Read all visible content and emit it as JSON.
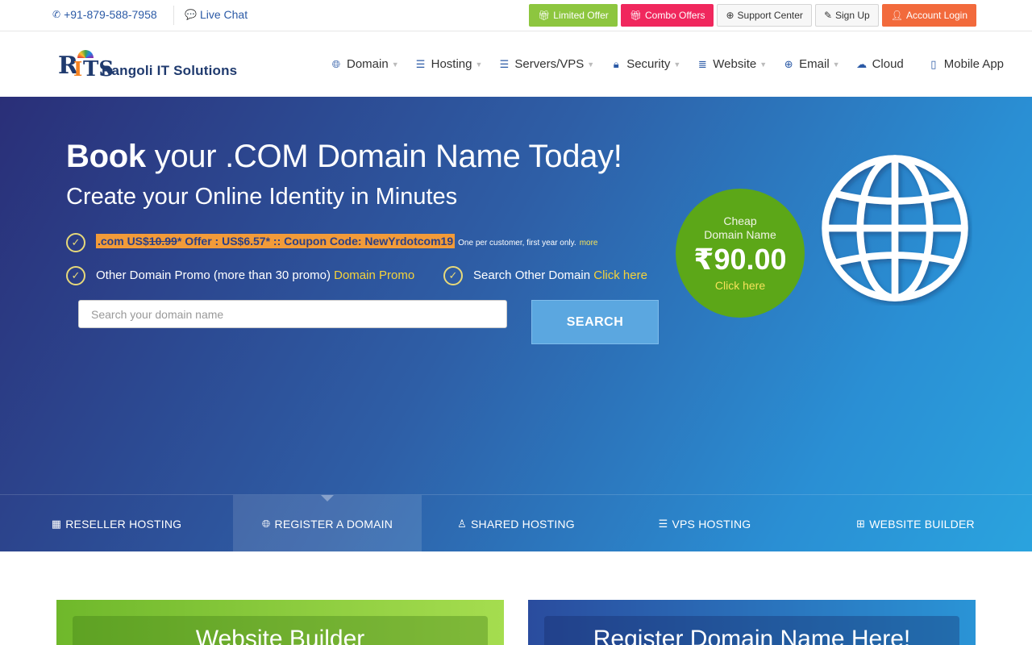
{
  "topbar": {
    "phone": "+91-879-588-7958",
    "chat": "Live Chat",
    "buttons": [
      {
        "label": "Limited Offer",
        "icon": "gift-icon",
        "color": "#8dc63f"
      },
      {
        "label": "Combo Offers",
        "icon": "gift-icon",
        "color": "#f0275d"
      },
      {
        "label": "Support Center",
        "icon": "lifebuoy-icon"
      },
      {
        "label": "Sign Up",
        "icon": "pencil-icon"
      },
      {
        "label": "Account Login",
        "icon": "user-icon",
        "color": "#f26a3c"
      }
    ]
  },
  "logo": {
    "mark": "RITS",
    "name": "Rangoli IT Solutions"
  },
  "nav": [
    {
      "label": "Domain",
      "icon": "globe-icon",
      "dropdown": true
    },
    {
      "label": "Hosting",
      "icon": "server-icon",
      "dropdown": true
    },
    {
      "label": "Servers/VPS",
      "icon": "server-stack-icon",
      "dropdown": true
    },
    {
      "label": "Security",
      "icon": "lock-icon",
      "dropdown": true
    },
    {
      "label": "Website",
      "icon": "list-icon",
      "dropdown": true
    },
    {
      "label": "Email",
      "icon": "lifebuoy-icon",
      "dropdown": true
    },
    {
      "label": "Cloud",
      "icon": "cloud-icon",
      "dropdown": false
    },
    {
      "label": "Mobile App",
      "icon": "mobile-icon",
      "dropdown": false
    }
  ],
  "hero": {
    "title_bold": "Book",
    "title_rest": "your .COM Domain Name Today!",
    "subtitle": "Create your Online Identity in Minutes",
    "promo": {
      "prefix": ".com US$",
      "old_price": "10.99",
      "offer": "* Offer : US$6.57* :: Coupon Code: NewYrdotcom19",
      "note": "One per customer, first year only.",
      "more": "more"
    },
    "other_promo": {
      "text": "Other Domain Promo (more than 30 promo)",
      "link": "Domain Promo"
    },
    "other_search": {
      "text": "Search Other Domain",
      "link": "Click here"
    },
    "search": {
      "placeholder": "Search your domain name",
      "button": "SEARCH"
    },
    "badge": {
      "line1": "Cheap",
      "line2": "Domain Name",
      "price": "₹90.00",
      "link": "Click here"
    }
  },
  "tabs": [
    {
      "label": "RESELLER HOSTING",
      "icon": "grid-icon",
      "active": false
    },
    {
      "label": "REGISTER A DOMAIN",
      "icon": "globe-icon",
      "active": true
    },
    {
      "label": "SHARED HOSTING",
      "icon": "linux-icon",
      "active": false
    },
    {
      "label": "VPS HOSTING",
      "icon": "server-icon",
      "active": false
    },
    {
      "label": "WEBSITE BUILDER",
      "icon": "windows-icon",
      "active": false
    }
  ],
  "cards": [
    {
      "title": "Website Builder"
    },
    {
      "title": "Register Domain Name Here!"
    }
  ],
  "colors": {
    "hero_start": "#2a2f78",
    "hero_end": "#2aa3de",
    "badge": "#5ca718",
    "highlight": "#f29b39",
    "link_yellow": "#f5d33a"
  }
}
